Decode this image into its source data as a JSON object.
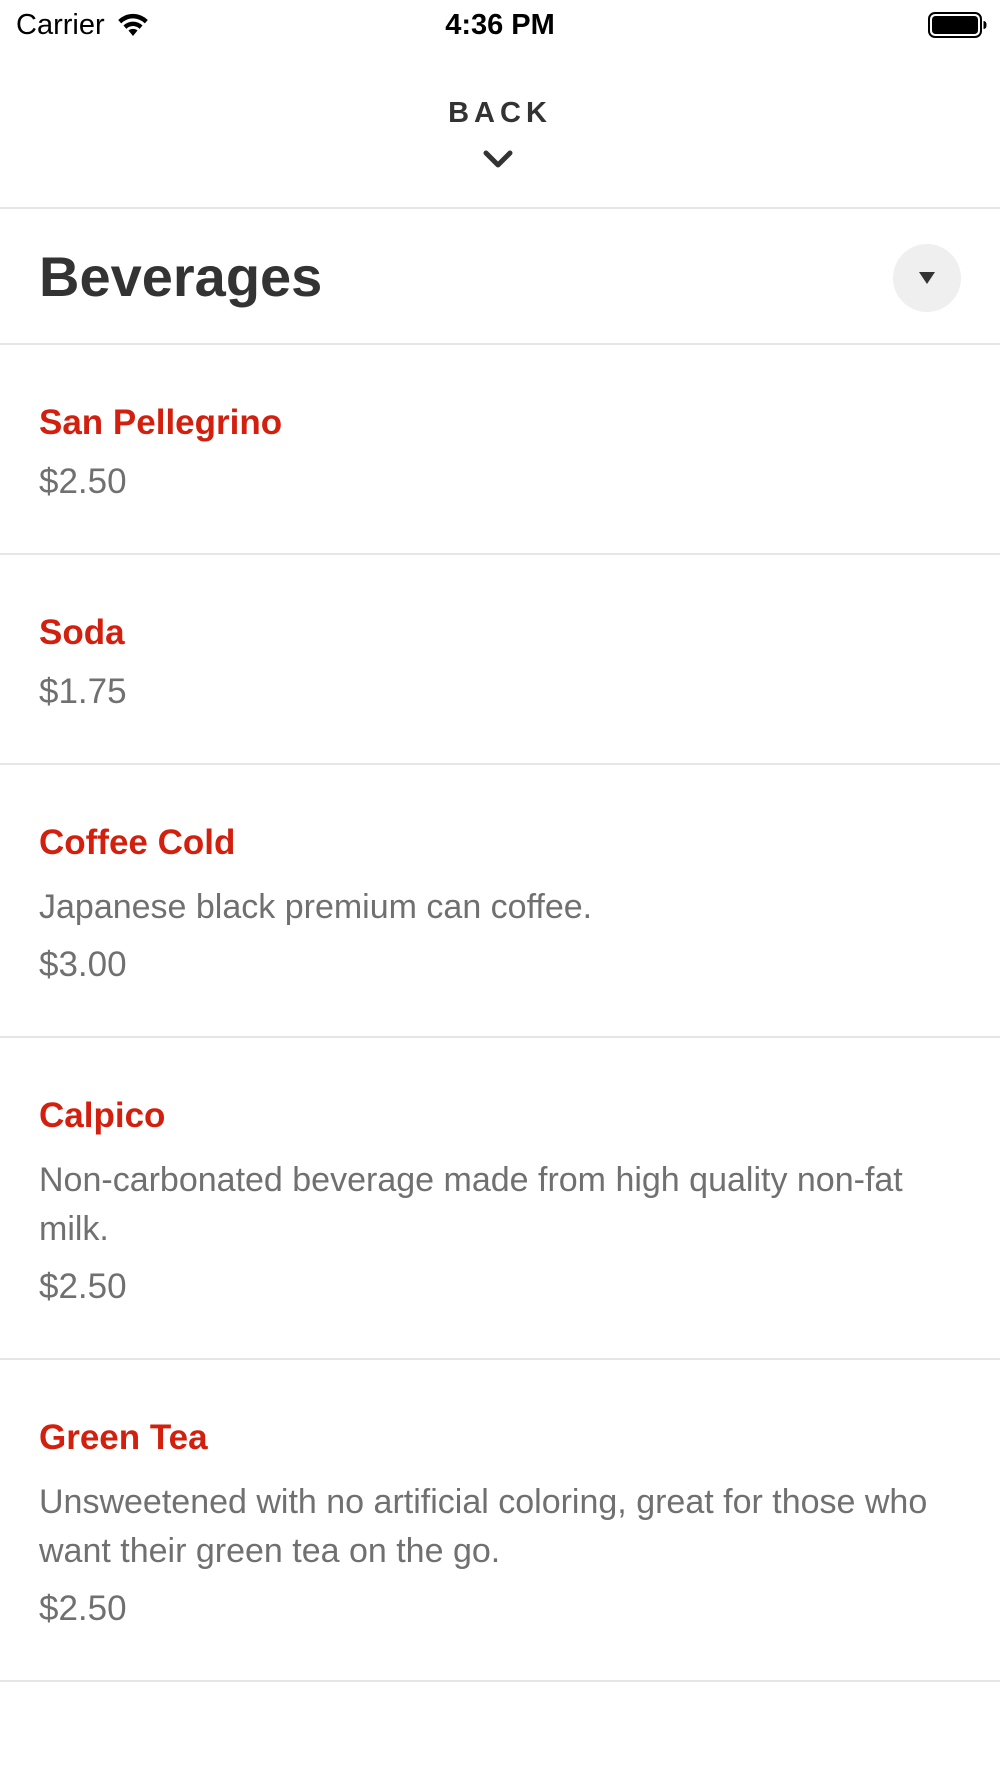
{
  "status_bar": {
    "carrier": "Carrier",
    "time": "4:36 PM",
    "icons": [
      "wifi-icon",
      "battery-icon"
    ]
  },
  "header": {
    "back_label": "BACK",
    "back_icon": "chevron-down-icon"
  },
  "category": {
    "title": "Beverages",
    "dropdown_icon": "caret-down-icon"
  },
  "menu": {
    "items": [
      {
        "name": "San Pellegrino",
        "description": "",
        "price": "$2.50"
      },
      {
        "name": "Soda",
        "description": "",
        "price": "$1.75"
      },
      {
        "name": "Coffee Cold",
        "description": "Japanese black premium can coffee.",
        "price": "$3.00"
      },
      {
        "name": "Calpico",
        "description": "Non-carbonated beverage made from high quality non-fat milk.",
        "price": "$2.50"
      },
      {
        "name": "Green Tea",
        "description": "Unsweetened with no artificial coloring, great for those who want their green tea on the go.",
        "price": "$2.50"
      }
    ]
  },
  "colors": {
    "item_name": "#d3200e",
    "text_primary": "#333333",
    "text_secondary": "#707070",
    "divider": "#e6e6e6",
    "dropdown_bg": "#efefef"
  }
}
